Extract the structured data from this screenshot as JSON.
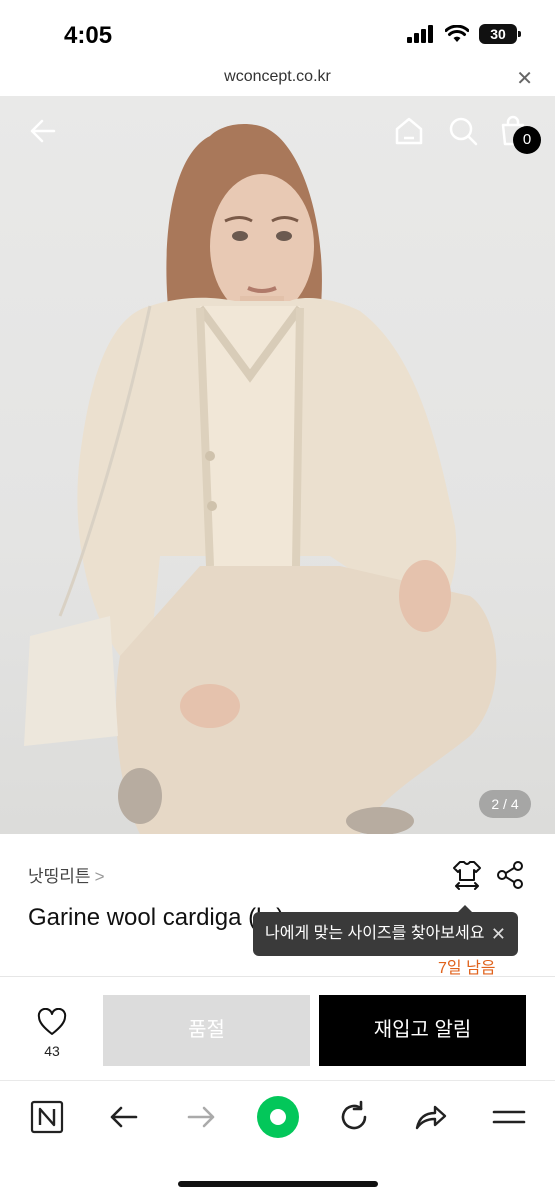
{
  "status_bar": {
    "time": "4:05",
    "battery": "30"
  },
  "browser": {
    "url": "wconcept.co.kr",
    "close_icon": "close-icon"
  },
  "hero": {
    "back_icon": "back-arrow-icon",
    "home_icon": "home-icon",
    "search_icon": "search-icon",
    "cart_icon": "shopping-bag-icon",
    "cart_count": "0",
    "page_indicator": "2 / 4"
  },
  "product": {
    "brand": "낫띵리튼",
    "brand_arrow": ">",
    "title": "Garine wool cardiga  (b   )",
    "size_icon": "size-guide-icon",
    "share_icon": "share-icon",
    "tooltip_text": "나에게 맞는 사이즈를 찾아보세요",
    "tooltip_close": "✕",
    "days_left": "7일 남음"
  },
  "actions": {
    "like_count": "43",
    "soldout_label": "품절",
    "restock_label": "재입고 알림"
  },
  "toolbar": {
    "icons": [
      "naver-n-icon",
      "back-icon",
      "forward-icon",
      "green-home-icon",
      "reload-icon",
      "share-forward-icon",
      "menu-icon"
    ]
  },
  "colors": {
    "accent_orange": "#e0621c",
    "green": "#03c75a"
  }
}
